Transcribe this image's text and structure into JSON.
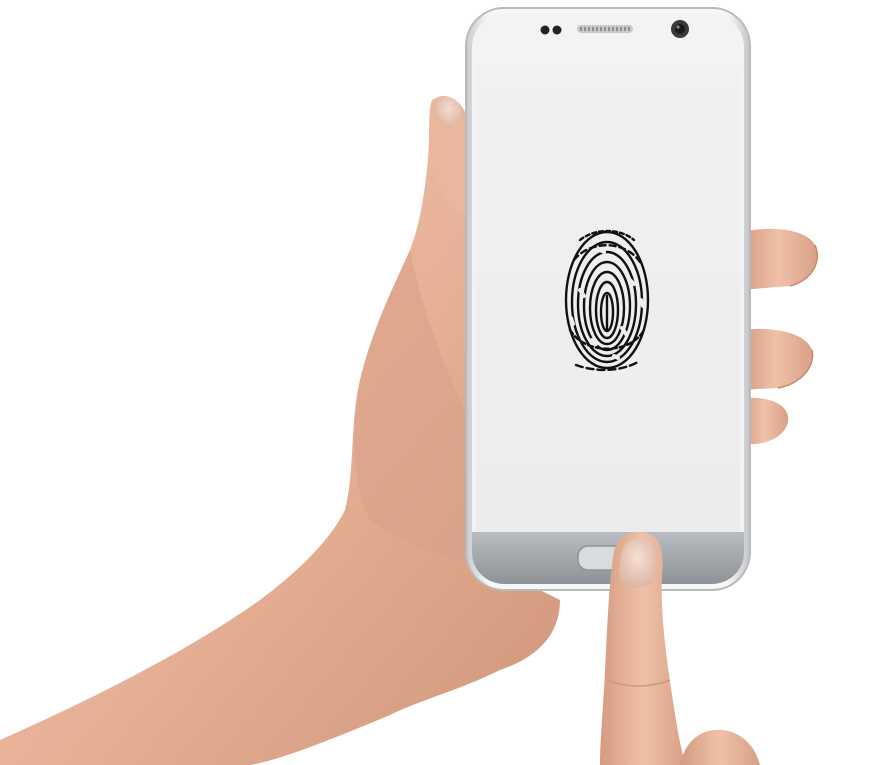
{
  "scene": {
    "subject": "hand-holding-phone-fingerprint-unlock",
    "background_color": "#ffffff",
    "skin_color": "#e8b49a",
    "skin_shadow_color": "#c98f74",
    "phone_frame_color": "#f4f4f4",
    "phone_bezel_color": "#e2e2e2",
    "screen_color": "#eeeeee",
    "bottom_bezel_color": "#a9adb1",
    "fingerprint_color": "#111111",
    "icons": [
      "fingerprint-icon",
      "front-camera-icon",
      "earpiece-speaker-icon",
      "proximity-sensor-icon",
      "home-button-icon"
    ]
  }
}
